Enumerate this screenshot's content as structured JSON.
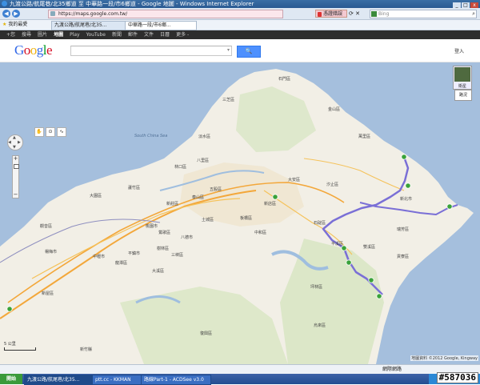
{
  "window": {
    "title": "九渡公路/航尾巷/北35鄉道 至 中華路一段/市6鄉道 - Google 地圖 - Windows Internet Explorer",
    "minimize": "_",
    "maximize": "□",
    "close": "x"
  },
  "addressbar": {
    "url": "https://maps.google.com.tw/",
    "cert_error": "憑證錯誤",
    "search_placeholder": "Bing",
    "back": "◀",
    "forward": "▶"
  },
  "favorites": {
    "label": "我的最愛",
    "tabs": [
      {
        "label": "九渡公路/航尾巷/北35...",
        "active": false
      },
      {
        "label": "中華路一段/市6鄉...",
        "active": true
      }
    ]
  },
  "google_bar": {
    "items": [
      "+您",
      "搜尋",
      "圖片",
      "地圖",
      "Play",
      "YouTube",
      "新聞",
      "郵件",
      "文件",
      "日曆",
      "更多 -"
    ],
    "selected_index": 3
  },
  "header": {
    "logo": "Google",
    "search_button": "🔍",
    "signin": "登入"
  },
  "map": {
    "satellite_label": "衛星",
    "traffic_label": "路況",
    "scale_label": "5 公里",
    "copyright": "地圖資料 ©2012 Google, Kingway",
    "route_color": "#7a6fd6",
    "waypoint_color": "#3aa23a",
    "labels": {
      "sea": "South China Sea",
      "places": [
        "石門區",
        "三芝區",
        "金山區",
        "萬里區",
        "淡水區",
        "八里區",
        "林口區",
        "五股區",
        "泰山區",
        "新莊區",
        "大園區",
        "蘆竹區",
        "觀音區",
        "桃園市",
        "八德市",
        "中壢市",
        "平鎮市",
        "鶯歌區",
        "三峽區",
        "樹林區",
        "土城區",
        "板橋區",
        "中和區",
        "新店區",
        "大安區",
        "汐止區",
        "瑞芳區",
        "貢寮區",
        "雙溪區",
        "平溪區",
        "石碇區",
        "坪林區",
        "烏來區",
        "大溪區",
        "龍潭區",
        "楊梅市",
        "新屋區",
        "復興區",
        "新北市",
        "新竹縣"
      ]
    }
  },
  "status": {
    "zone": "網際網路"
  },
  "taskbar": {
    "start": "開始",
    "tasks": [
      {
        "label": "九渡公路/航尾巷/北35...",
        "active": true
      },
      {
        "label": "ptt.cc - KKMAN",
        "active": false
      },
      {
        "label": "路線Part-1 - ACDSee v3.0",
        "active": false
      }
    ]
  },
  "watermark": "#587036"
}
